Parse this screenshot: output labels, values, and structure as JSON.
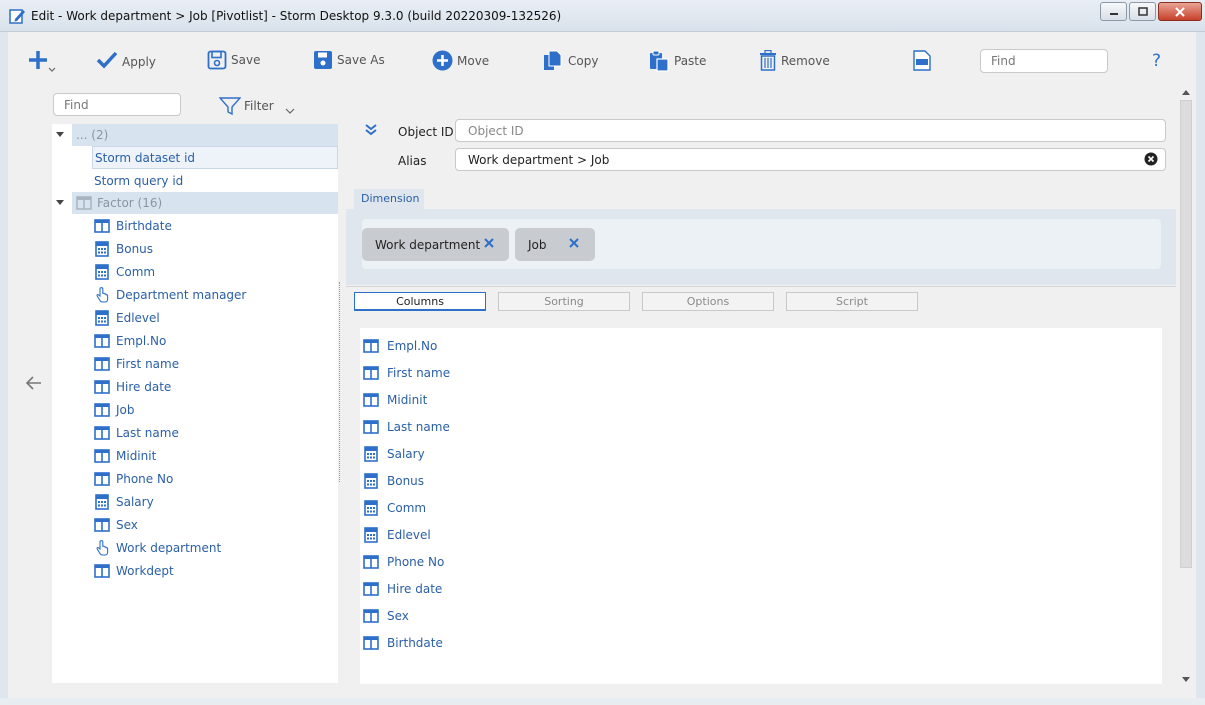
{
  "window": {
    "title": "Edit - Work department > Job [Pivotlist] -  Storm Desktop 9.3.0 (build 20220309-132526)"
  },
  "toolbar": {
    "apply": "Apply",
    "save": "Save",
    "save_as": "Save As",
    "move": "Move",
    "copy": "Copy",
    "paste": "Paste",
    "remove": "Remove",
    "find_placeholder": "Find",
    "help": "?"
  },
  "left_panel": {
    "find_placeholder": "Find",
    "filter_label": "Filter",
    "group1": "... (2)",
    "group1_items": [
      "Storm dataset id",
      "Storm query id"
    ],
    "group2": "Factor (16)",
    "group2_items": [
      {
        "label": "Birthdate",
        "icon": "table-icon"
      },
      {
        "label": "Bonus",
        "icon": "calculator-icon"
      },
      {
        "label": "Comm",
        "icon": "calculator-icon"
      },
      {
        "label": "Department manager",
        "icon": "pointer-icon"
      },
      {
        "label": "Edlevel",
        "icon": "calculator-icon"
      },
      {
        "label": "Empl.No",
        "icon": "table-icon"
      },
      {
        "label": "First name",
        "icon": "table-icon"
      },
      {
        "label": "Hire date",
        "icon": "table-icon"
      },
      {
        "label": "Job",
        "icon": "table-icon"
      },
      {
        "label": "Last name",
        "icon": "table-icon"
      },
      {
        "label": "Midinit",
        "icon": "table-icon"
      },
      {
        "label": "Phone No",
        "icon": "table-icon"
      },
      {
        "label": "Salary",
        "icon": "calculator-icon"
      },
      {
        "label": "Sex",
        "icon": "table-icon"
      },
      {
        "label": "Work department",
        "icon": "pointer-icon"
      },
      {
        "label": "Workdept",
        "icon": "table-icon"
      }
    ]
  },
  "properties": {
    "object_id_label": "Object ID",
    "object_id_placeholder": "Object ID",
    "object_id_value": "",
    "alias_label": "Alias",
    "alias_value": "Work department > Job"
  },
  "dimension": {
    "tab_label": "Dimension",
    "chips": [
      "Work department",
      "Job"
    ]
  },
  "tabs": [
    "Columns",
    "Sorting",
    "Options",
    "Script"
  ],
  "columns": [
    {
      "label": "Empl.No",
      "icon": "table-icon"
    },
    {
      "label": "First name",
      "icon": "table-icon"
    },
    {
      "label": "Midinit",
      "icon": "table-icon"
    },
    {
      "label": "Last name",
      "icon": "table-icon"
    },
    {
      "label": "Salary",
      "icon": "calculator-icon"
    },
    {
      "label": "Bonus",
      "icon": "calculator-icon"
    },
    {
      "label": "Comm",
      "icon": "calculator-icon"
    },
    {
      "label": "Edlevel",
      "icon": "calculator-icon"
    },
    {
      "label": "Phone No",
      "icon": "table-icon"
    },
    {
      "label": "Hire date",
      "icon": "table-icon"
    },
    {
      "label": "Sex",
      "icon": "table-icon"
    },
    {
      "label": "Birthdate",
      "icon": "table-icon"
    }
  ],
  "colors": {
    "accent": "#2e6fc9",
    "link": "#2a5fa6",
    "tree_group_bg": "#d7e3ef"
  }
}
